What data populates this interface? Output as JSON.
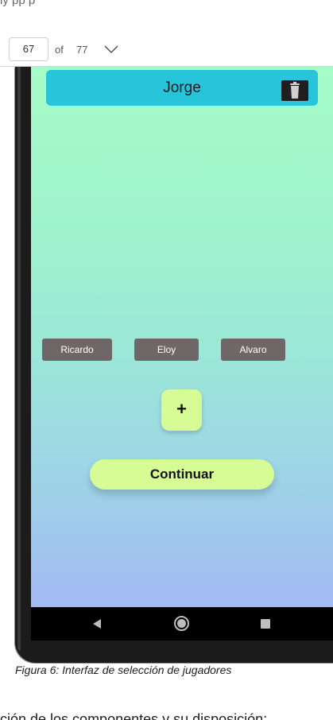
{
  "document": {
    "top_text": "ly pp              p",
    "caption": "Figura 6: Interfaz de selección de jugadores",
    "bottom_text": "ción de los componentes y su disposición:"
  },
  "viewer": {
    "page_input_value": "67",
    "of_label": "of",
    "total_pages": "77",
    "dropdown_icon": "chevron-down-icon"
  },
  "app": {
    "selected_player": "Jorge",
    "delete_icon": "trash-icon",
    "players": [
      "Ricardo",
      "Eloy",
      "Alvaro"
    ],
    "add_button_label": "+",
    "continue_button_label": "Continuar",
    "colors": {
      "name_bar": "#27c4da",
      "player_chip": "#6f6668",
      "button_fill": "#d7fb95",
      "gradient_top": "#a6fcc7",
      "gradient_bottom": "#a3b9f2"
    }
  },
  "nav": {
    "back_icon": "back-triangle-icon",
    "home_icon": "home-circle-icon",
    "recent_icon": "recent-apps-square-icon"
  }
}
